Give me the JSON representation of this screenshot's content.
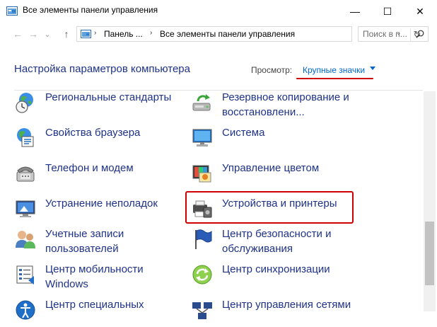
{
  "window": {
    "title": "Все элементы панели управления",
    "minimize": "—",
    "maximize": "☐",
    "close": "✕"
  },
  "address": {
    "back": "←",
    "forward": "→",
    "dropdown": "⌄",
    "up": "↑",
    "crumbs": [
      "Панель ...",
      "Все элементы панели управления"
    ],
    "separator": "›",
    "refresh": "↻",
    "search_placeholder": "Поиск в п..."
  },
  "content": {
    "heading": "Настройка параметров компьютера",
    "view_label": "Просмотр:",
    "view_value": "Крупные значки"
  },
  "items": [
    {
      "label": "Региональные стандарты",
      "icon": "region-clock-icon"
    },
    {
      "label": "Резервное копирование и восстановлени...",
      "icon": "backup-restore-icon"
    },
    {
      "label": "Свойства браузера",
      "icon": "internet-options-icon"
    },
    {
      "label": "Система",
      "icon": "system-monitor-icon"
    },
    {
      "label": "Телефон и модем",
      "icon": "phone-modem-icon"
    },
    {
      "label": "Управление цветом",
      "icon": "color-management-icon"
    },
    {
      "label": "Устранение неполадок",
      "icon": "troubleshooting-icon"
    },
    {
      "label": "Устройства и принтеры",
      "icon": "devices-printers-icon"
    },
    {
      "label": "Учетные записи пользователей",
      "icon": "user-accounts-icon"
    },
    {
      "label": "Центр безопасности и обслуживания",
      "icon": "security-flag-icon"
    },
    {
      "label": "Центр мобильности Windows",
      "icon": "mobility-center-icon"
    },
    {
      "label": "Центр синхронизации",
      "icon": "sync-center-icon"
    },
    {
      "label": "Центр специальных",
      "icon": "ease-of-access-icon"
    },
    {
      "label": "Центр управления сетями",
      "icon": "network-center-icon"
    }
  ],
  "colors": {
    "link": "#1e3287",
    "accent": "#0066cc",
    "highlight": "#d00000"
  }
}
